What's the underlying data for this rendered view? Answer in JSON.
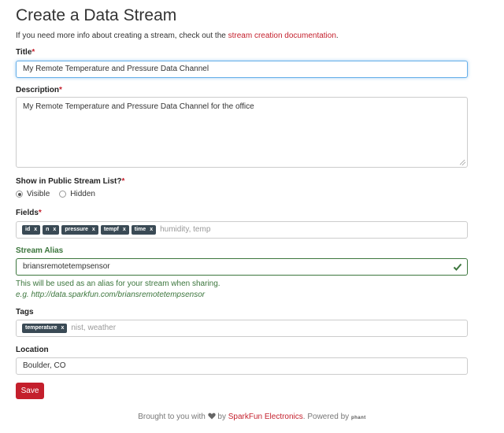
{
  "page_title": "Create a Data Stream",
  "intro": {
    "text": "If you need more info about creating a stream, check out the ",
    "link": "stream creation documentation",
    "suffix": "."
  },
  "title_field": {
    "label": "Title",
    "value": "My Remote Temperature and Pressure Data Channel"
  },
  "description_field": {
    "label": "Description",
    "value": "My Remote Temperature and Pressure Data Channel for the office"
  },
  "visibility": {
    "label": "Show in Public Stream List?",
    "options": [
      "Visible",
      "Hidden"
    ],
    "selected": "Visible"
  },
  "fields": {
    "label": "Fields",
    "tags": [
      "id",
      "n",
      "pressure",
      "tempf",
      "time"
    ],
    "placeholder": "humidity, temp"
  },
  "alias": {
    "label": "Stream Alias",
    "value": "briansremotetempsensor",
    "help": "This will be used as an alias for your stream when sharing.",
    "example": "e.g. http://data.sparkfun.com/briansremotetempsensor"
  },
  "tags_field": {
    "label": "Tags",
    "tags": [
      "temperature"
    ],
    "placeholder": "nist, weather"
  },
  "location": {
    "label": "Location",
    "value": "Boulder, CO"
  },
  "save_label": "Save",
  "footer": {
    "prefix": "Brought to you with",
    "by": "by",
    "brand": "SparkFun Electronics",
    "powered": ". Powered by",
    "powered_logo": "phant"
  },
  "required_marker": "*",
  "tag_remove": "x",
  "colors": {
    "accent": "#c41f2c",
    "success": "#3c763d",
    "tag_bg": "#3a4a55",
    "focus": "#66afe9"
  },
  "icons": [
    "heart-icon",
    "check-icon",
    "close-icon"
  ]
}
